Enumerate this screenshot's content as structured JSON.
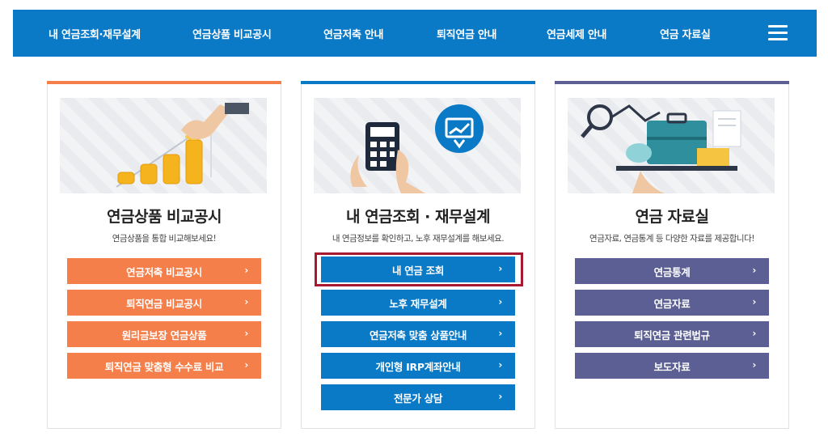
{
  "nav": {
    "items": [
      "내 연금조회·재무설계",
      "연금상품 비교공시",
      "연금저축 안내",
      "퇴직연금 안내",
      "연금세제 안내",
      "연금 자료실"
    ],
    "menu_icon": "hamburger-icon"
  },
  "colors": {
    "nav_bg": "#0b7ac6",
    "orange": "#f47f4b",
    "blue": "#0b7ac6",
    "purple": "#5b5f93",
    "highlight": "#a8192f"
  },
  "cards": [
    {
      "title": "연금상품 비교공시",
      "subtitle": "연금상품을 통합 비교해보세요!",
      "illustration": "coins-growth-icon",
      "buttons": [
        "연금저축 비교공시",
        "퇴직연금 비교공시",
        "원리금보장 연금상품",
        "퇴직연금 맞춤형 수수료 비교"
      ]
    },
    {
      "title": "내 연금조회 · 재무설계",
      "subtitle": "내 연금정보를 확인하고, 노후 재무설계를 해보세요.",
      "illustration": "calculator-chart-icon",
      "buttons": [
        "내 연금 조회",
        "노후 재무설계",
        "연금저축 맞춤 상품안내",
        "개인형 IRP계좌안내",
        "전문가 상담"
      ]
    },
    {
      "title": "연금 자료실",
      "subtitle": "연금자료, 연금통계 등 다양한 자료를 제공합니다!",
      "illustration": "briefcase-piggybank-icon",
      "buttons": [
        "연금통계",
        "연금자료",
        "퇴직연금 관련법규",
        "보도자료"
      ]
    }
  ],
  "chevron": "›"
}
